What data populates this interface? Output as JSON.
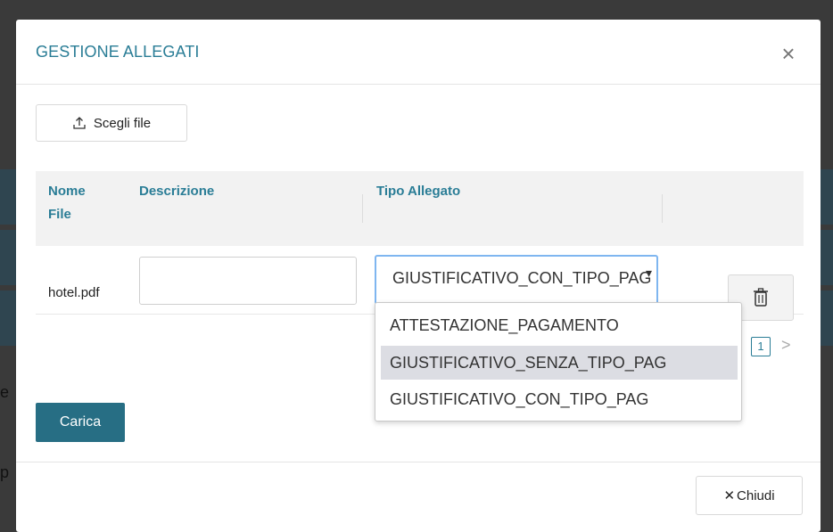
{
  "modal": {
    "title": "GESTIONE ALLEGATI",
    "close_symbol": "×",
    "choose_file_label": "Scegli file",
    "upload_label": "Carica",
    "close_label": "Chiudi",
    "close_icon_symbol": "✕"
  },
  "table": {
    "headers": {
      "name_line1": "Nome",
      "name_line2": "File",
      "description": "Descrizione",
      "type": "Tipo Allegato"
    },
    "rows": [
      {
        "file_name": "hotel.pdf",
        "description": "",
        "type_value": "GIUSTIFICATIVO_CON_TIPO_PAG"
      }
    ]
  },
  "pagination": {
    "current_page": "1",
    "next_symbol": ">"
  },
  "dropdown": {
    "options": [
      "ATTESTAZIONE_PAGAMENTO",
      "GIUSTIFICATIVO_SENZA_TIPO_PAG",
      "GIUSTIFICATIVO_CON_TIPO_PAG"
    ],
    "highlighted_index": 1
  },
  "background": {
    "partial_text_1": "e",
    "partial_text_2": "p"
  },
  "colors": {
    "accent": "#2a7d96",
    "primary_button": "#276e84",
    "focus_border": "#7fb6f0",
    "highlight": "#dcdde3"
  },
  "icons": {
    "upload": "upload-icon",
    "trash": "trash-icon",
    "close": "close-icon",
    "caret": "caret-down-icon"
  }
}
